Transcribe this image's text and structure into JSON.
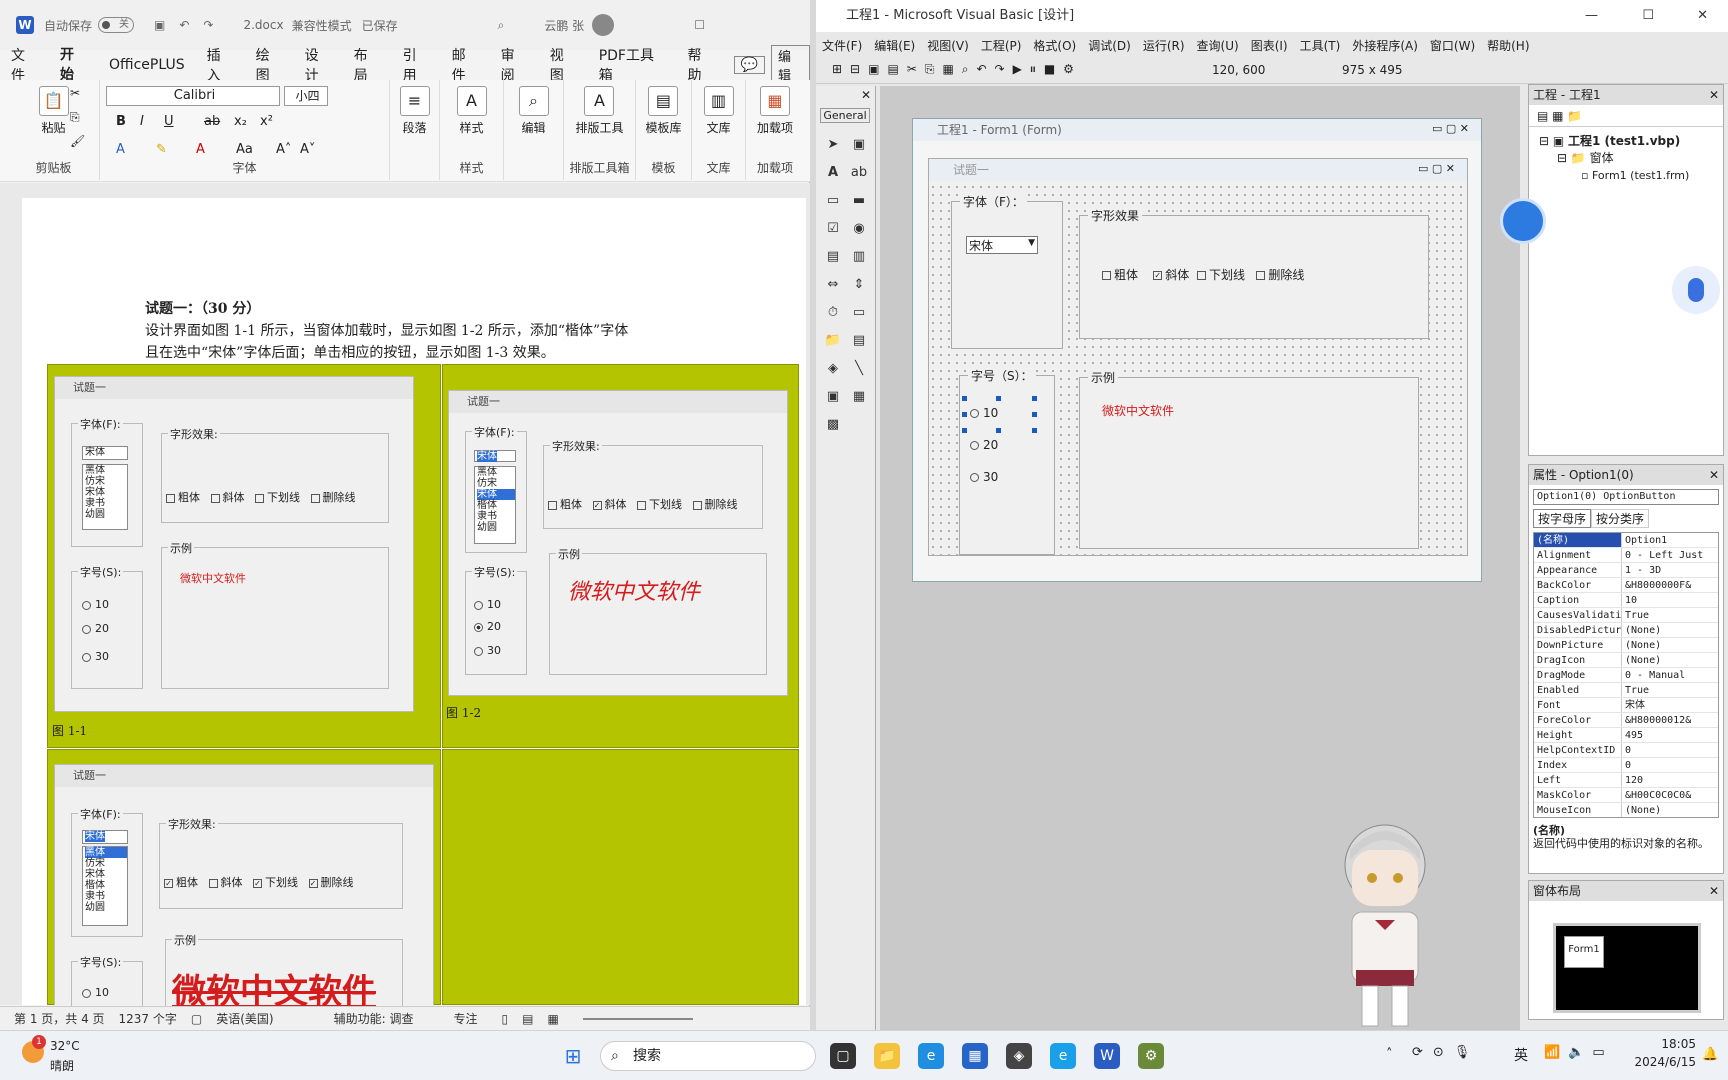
{
  "word": {
    "autosave_label": "自动保存",
    "autosave_state": "关",
    "filename": "2.docx",
    "mode": "兼容性模式",
    "saved": "已保存",
    "user": "云鹏 张",
    "tabs": [
      "文件",
      "开始",
      "OfficePLUS",
      "插入",
      "绘图",
      "设计",
      "布局",
      "引用",
      "邮件",
      "审阅",
      "视图",
      "PDF工具箱",
      "帮助"
    ],
    "edit_button": "编辑",
    "ribbon": {
      "paste": "粘贴",
      "clipboard": "剪贴板",
      "font_name": "Calibri",
      "font_size": "小四",
      "font_group": "字体",
      "paragraph": "段落",
      "styles": "样式",
      "styles_group": "样式",
      "editing": "编辑",
      "layout_tool": "排版工具",
      "layout_tool_group": "排版工具箱",
      "template_lib": "模板库",
      "template_group": "模板",
      "library": "文库",
      "library_group": "文库",
      "addins": "加载项",
      "addins_group": "加载项"
    },
    "doc": {
      "heading": "试题一：（30 分）",
      "para1": "设计界面如图 1-1 所示，当窗体加载时，显示如图 1-2 所示，添加“楷体”字体",
      "para2": "且在选中“宋体”字体后面；单击相应的按钮，显示如图 1-3 效果。",
      "fig1": "图 1-1",
      "fig2": "图 1-2"
    },
    "shot": {
      "title": "试题一",
      "font_label": "字体(F):",
      "effects_label": "字形效果:",
      "size_label": "字号(S):",
      "sample_label": "示例",
      "sample_text": "微软中文软件",
      "fonts1": [
        "宋体",
        "黑体",
        "仿宋",
        "宋体",
        "隶书",
        "幼圆"
      ],
      "fonts2": [
        "宋体",
        "黑体",
        "仿宋",
        "宋体",
        "楷体",
        "隶书",
        "幼圆"
      ],
      "fonts3": [
        "宋体",
        "黑体",
        "仿宋",
        "宋体",
        "楷体",
        "隶书",
        "幼圆"
      ],
      "bold": "粗体",
      "italic": "斜体",
      "underline": "下划线",
      "strike": "删除线",
      "s10": "10",
      "s20": "20",
      "s30": "30"
    },
    "status": {
      "page": "第 1 页，共 4 页",
      "words": "1237 个字",
      "lang": "英语(美国)",
      "access": "辅助功能: 调查",
      "focus": "专注"
    }
  },
  "vb": {
    "title": "工程1 - Microsoft Visual Basic [设计]",
    "menu": [
      "文件(F)",
      "编辑(E)",
      "视图(V)",
      "工程(P)",
      "格式(O)",
      "调试(D)",
      "运行(R)",
      "查询(U)",
      "图表(I)",
      "工具(T)",
      "外接程序(A)",
      "窗口(W)",
      "帮助(H)"
    ],
    "pos": "120, 600",
    "size": "975 x 495",
    "toolbox_title": "General",
    "form_window_title": "工程1 - Form1 (Form)",
    "form_caption": "试题一",
    "font_label": "字体（F）：",
    "font_combo": "宋体",
    "effects_label": "字形效果",
    "bold": "粗体",
    "italic": "斜体",
    "underline": "下划线",
    "strike": "删除线",
    "size_label": "字号（S）：",
    "s10": "10",
    "s20": "20",
    "s30": "30",
    "sample_label": "示例",
    "sample_text": "微软中文软件",
    "project": {
      "title": "工程 - 工程1",
      "root": "工程1 (test1.vbp)",
      "folder": "窗体",
      "form": "Form1 (test1.frm)"
    },
    "props": {
      "title": "属性 - Option1(0)",
      "object": "Option1(0) OptionButton",
      "tab1": "按字母序",
      "tab2": "按分类序",
      "rows": [
        {
          "k": "(名称)",
          "v": "Option1"
        },
        {
          "k": "Alignment",
          "v": "0 - Left Just"
        },
        {
          "k": "Appearance",
          "v": "1 - 3D"
        },
        {
          "k": "BackColor",
          "v": "&H8000000F&"
        },
        {
          "k": "Caption",
          "v": "10"
        },
        {
          "k": "CausesValidati",
          "v": "True"
        },
        {
          "k": "DisabledPictur",
          "v": "(None)"
        },
        {
          "k": "DownPicture",
          "v": "(None)"
        },
        {
          "k": "DragIcon",
          "v": "(None)"
        },
        {
          "k": "DragMode",
          "v": "0 - Manual"
        },
        {
          "k": "Enabled",
          "v": "True"
        },
        {
          "k": "Font",
          "v": "宋体"
        },
        {
          "k": "ForeColor",
          "v": "&H80000012&"
        },
        {
          "k": "Height",
          "v": "495"
        },
        {
          "k": "HelpContextID",
          "v": "0"
        },
        {
          "k": "Index",
          "v": "0"
        },
        {
          "k": "Left",
          "v": "120"
        },
        {
          "k": "MaskColor",
          "v": "&H00C0C0C0&"
        },
        {
          "k": "MouseIcon",
          "v": "(None)"
        }
      ],
      "desc_title": "(名称)",
      "desc": "返回代码中使用的标识对象的名称。"
    },
    "layout_title": "窗体布局",
    "layout_form": "Form1"
  },
  "taskbar": {
    "temp": "32°C",
    "weather": "晴朗",
    "search": "搜索",
    "ime": "英",
    "time": "18:05",
    "date": "2024/6/15",
    "badge": "1"
  },
  "colors": {
    "accent": "#1d5fc0",
    "sample_red": "#d51c1c",
    "figure_bg": "#b4c400"
  }
}
